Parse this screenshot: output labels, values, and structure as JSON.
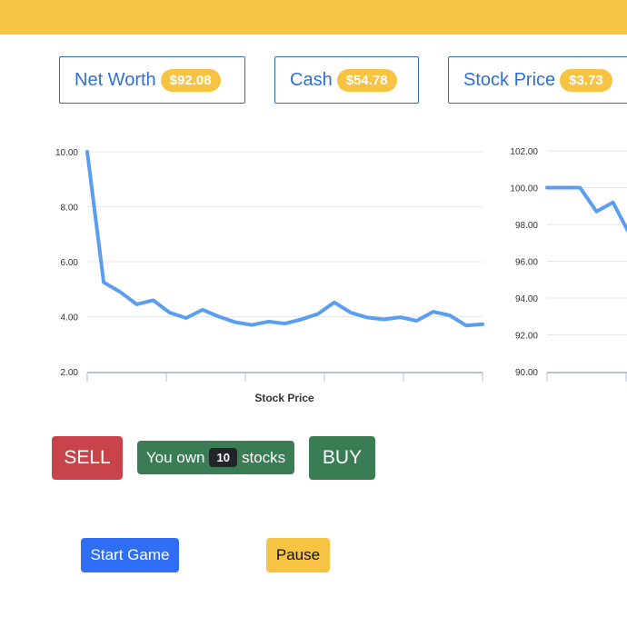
{
  "stats": {
    "net_worth_label": "Net Worth",
    "net_worth_value": "$92.08",
    "cash_label": "Cash",
    "cash_value": "$54.78",
    "stock_price_label": "Stock Price",
    "stock_price_value": "$3.73"
  },
  "controls": {
    "sell_label": "SELL",
    "own_prefix": "You own",
    "own_count": "10",
    "own_suffix": "stocks",
    "buy_label": "BUY",
    "start_label": "Start Game",
    "pause_label": "Pause"
  },
  "colors": {
    "accent_yellow": "#f6c343",
    "line_blue": "#5b9ef0",
    "sell_red": "#c9434a",
    "buy_green": "#3a7d55",
    "start_blue": "#2f6ef5"
  },
  "chart_data": [
    {
      "type": "line",
      "xlabel": "Stock Price",
      "ylim": [
        2,
        10
      ],
      "yticks": [
        "10.00",
        "8.00",
        "6.00",
        "4.00",
        "2.00"
      ],
      "grid": true,
      "values": [
        10.0,
        5.25,
        4.9,
        4.45,
        4.6,
        4.15,
        3.95,
        4.25,
        4.0,
        3.8,
        3.7,
        3.82,
        3.75,
        3.9,
        4.1,
        4.52,
        4.15,
        3.97,
        3.9,
        3.98,
        3.85,
        4.18,
        4.05,
        3.68,
        3.73
      ]
    },
    {
      "type": "line",
      "ylim": [
        90,
        102
      ],
      "yticks": [
        "102.00",
        "100.00",
        "98.00",
        "96.00",
        "94.00",
        "92.00",
        "90.00"
      ],
      "grid": true,
      "values": [
        100.0,
        100.0,
        100.0,
        98.7,
        99.2,
        97.5
      ]
    }
  ]
}
